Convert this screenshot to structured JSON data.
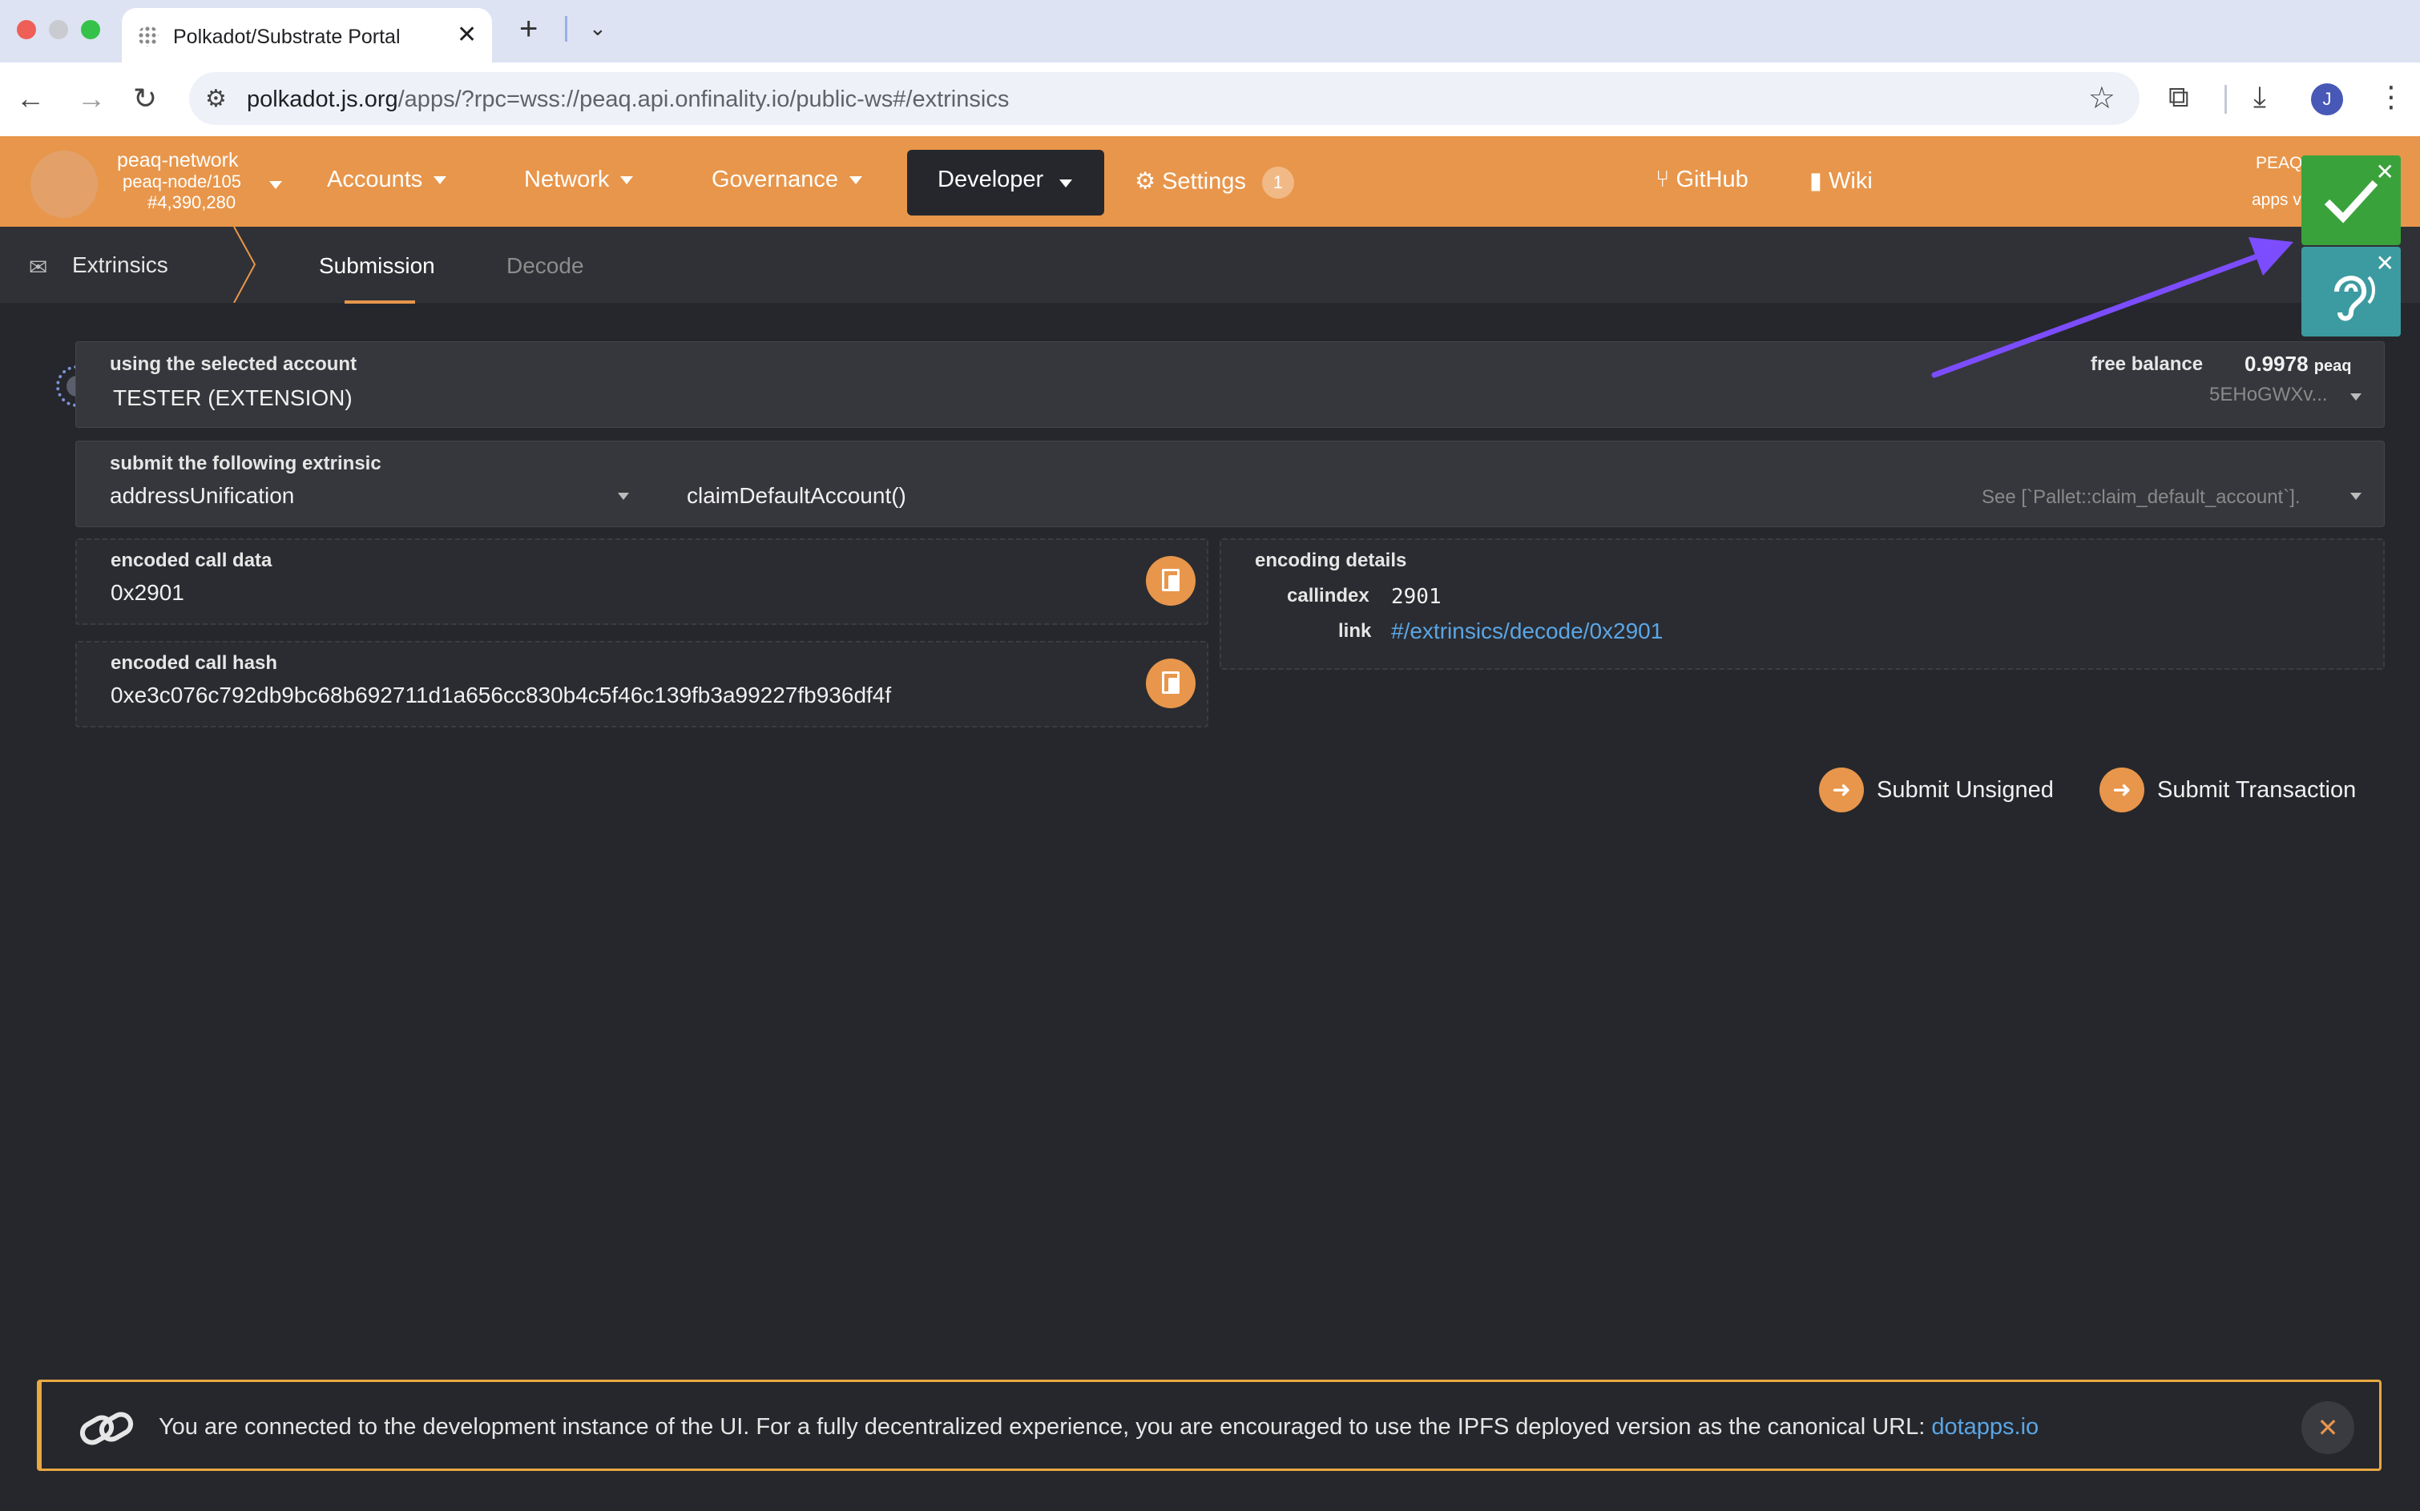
{
  "browser": {
    "tab_title": "Polkadot/Substrate Portal",
    "url_host": "polkadot.js.org",
    "url_path": "/apps/?rpc=wss://peaq.api.onfinality.io/public-ws#/extrinsics",
    "profile_initial": "J"
  },
  "header": {
    "chain_name": "peaq-network",
    "node": "peaq-node/105",
    "block": "#4,390,280",
    "menus": {
      "accounts": "Accounts",
      "network": "Network",
      "governance": "Governance",
      "developer": "Developer",
      "settings": "Settings",
      "settings_badge": "1",
      "github": "GitHub",
      "wiki": "Wiki"
    },
    "right_line1": "PEAQ No",
    "right_line2": "apps v"
  },
  "subnav": {
    "title": "Extrinsics",
    "tabs": {
      "submission": "Submission",
      "decode": "Decode"
    }
  },
  "account": {
    "label": "using the selected account",
    "name": "TESTER (EXTENSION)",
    "free_balance_label": "free balance",
    "balance": "0.9978",
    "unit": "peaq",
    "address": "5EHoGWXv..."
  },
  "extrinsic": {
    "label": "submit the following extrinsic",
    "pallet": "addressUnification",
    "call": "claimDefaultAccount()",
    "doc": "See [`Pallet::claim_default_account`]."
  },
  "encoded_call_data": {
    "label": "encoded call data",
    "value": "0x2901"
  },
  "encoded_call_hash": {
    "label": "encoded call hash",
    "value": "0xe3c076c792db9bc68b692711d1a656cc830b4c5f46c139fb3a99227fb936df4f"
  },
  "encoding_details": {
    "label": "encoding details",
    "callindex_label": "callindex",
    "callindex": "2901",
    "link_label": "link",
    "link": "#/extrinsics/decode/0x2901"
  },
  "actions": {
    "submit_unsigned": "Submit Unsigned",
    "submit_transaction": "Submit Transaction"
  },
  "notice": {
    "text": "You are connected to the development instance of the UI. For a fully decentralized experience, you are encouraged to use the IPFS deployed version as the canonical URL: ",
    "link": "dotapps.io"
  },
  "colors": {
    "accent": "#e8964b",
    "background": "#26272c",
    "link": "#5aa6e6",
    "arrow": "#7c4dff"
  }
}
